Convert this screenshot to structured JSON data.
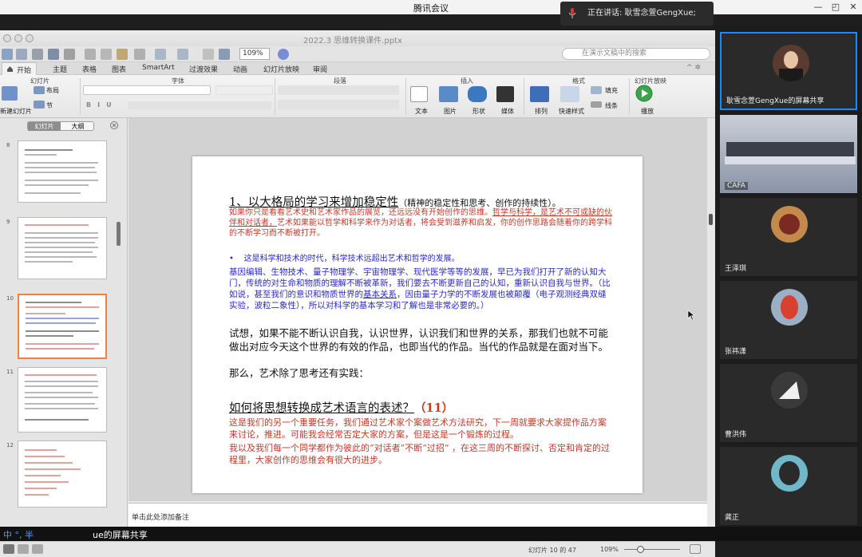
{
  "window": {
    "title": "腾讯会议",
    "minimize": "—",
    "restore": "◰",
    "close": "✕"
  },
  "speaking": {
    "text": "正在讲话: 耿雪念萱GengXue;"
  },
  "ppt": {
    "filename": "2022.3 思维转换课件.pptx",
    "zoom": "109%",
    "search_placeholder": "在演示文稿中的搜索",
    "tabs": [
      "开始",
      "主题",
      "表格",
      "图表",
      "SmartArt",
      "过渡效果",
      "动画",
      "幻灯片放映",
      "审阅"
    ],
    "groups": [
      "幻灯片",
      "字体",
      "段落",
      "插入",
      "格式",
      "幻灯片放映"
    ],
    "ribbon_labels": {
      "new_slide": "新建幻灯片",
      "layout": "布局",
      "section": "节",
      "text": "文本",
      "picture": "图片",
      "shape": "形状",
      "media": "媒体",
      "arrange": "排列",
      "quick_styles": "快速样式",
      "fill": "填充",
      "line": "线条",
      "play": "播放"
    },
    "view_switch": [
      "幻灯片",
      "大纲"
    ],
    "thumb_numbers": [
      "8",
      "9",
      "10",
      "11",
      "12"
    ],
    "notes_placeholder": "单击此处添加备注",
    "status": {
      "slide_of": "幻灯片 10 的 47",
      "zoom": "109%"
    }
  },
  "slide": {
    "heading1": "1、以大格局的学习来增加稳定性",
    "heading1_note": "（精神的稳定性和思考、创作的持续性）。",
    "para1_part1": "如果你只是看看艺术史和艺术家作品的展览，还远远没有开始创作的思维。",
    "para1_underlined": "哲学与科学，是艺术不可或缺的伙伴和对话者，",
    "para1_part2": "艺术如果能以哲学和科学来作为对话者，将会受到滋养和启发，你的创作思路会随着你的跨学科的不断学习而不断被打开。",
    "bullet": "这是科学和技术的时代，科学技术远超出艺术和哲学的发展。",
    "para2_part1": "基因编辑、生物技术、量子物理学、宇宙物理学、现代医学等等的发展，早已为我们打开了新的认知大门，传统的对生命和物质的理解不断被革新，我们要去不断更新自己的认知，重新认识自我与世界。（比如说，甚至我们的意识和物质世界的",
    "para2_underlined": "基本关系",
    "para2_part2": "，因由量子力学的不断发展也被颠覆（电子观测经典双缝实验，波粒二象性），所以对科学的基本学习和了解也是非常必要的。）",
    "para3": "试想，如果不能不断认识自我，认识世界，认识我们和世界的关系，那我们也就不可能做出对应今天这个世界的有效的作品，也即当代的作品。当代的作品就是在面对当下。",
    "para4": "那么，艺术除了思考还有实践：",
    "heading2": "如何将思想转换成艺术语言的表述？",
    "heading2_num": "（11）",
    "para5": "这是我们的另一个重要任务，我们通过艺术家个案做艺术方法研究，下一周就要求大家提作品方案来讨论，推进。可能我会经常否定大家的方案，但是这是一个锻炼的过程。",
    "para6": "我以及我们每一个同学都作为彼此的“对话者”不断“过招” ，在这三周的不断探讨、否定和肯定的过程里，大家创作的思维会有很大的进步。"
  },
  "participants": [
    {
      "name": "耿雪念萱GengXue的屏幕共享"
    },
    {
      "name": "CAFA"
    },
    {
      "name": "王泽琪"
    },
    {
      "name": "张祎潇"
    },
    {
      "name": "曹洪伟"
    },
    {
      "name": "龚正"
    }
  ],
  "bottom": {
    "share_text": "ue的屏幕共享",
    "ime_text": "中 °, 半"
  }
}
